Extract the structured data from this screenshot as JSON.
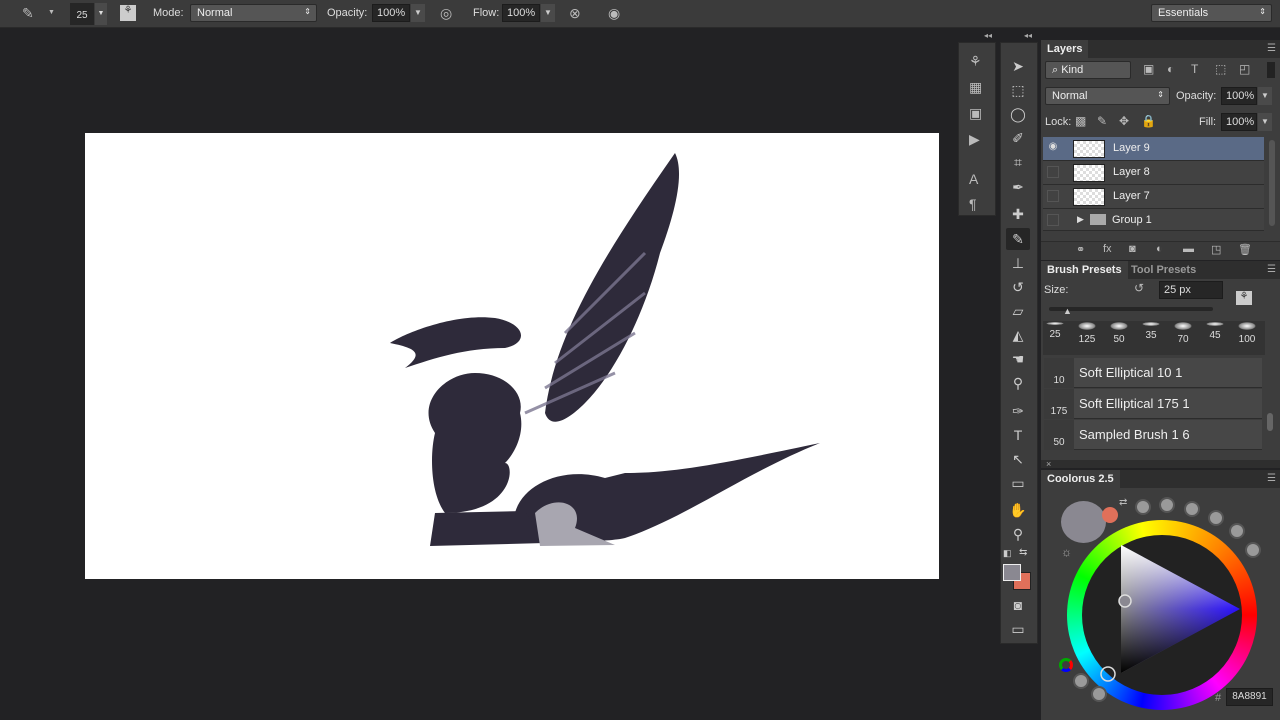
{
  "options_bar": {
    "brush_size": "25",
    "mode_label": "Mode:",
    "mode_value": "Normal",
    "opacity_label": "Opacity:",
    "opacity_value": "100%",
    "flow_label": "Flow:",
    "flow_value": "100%",
    "workspace": "Essentials"
  },
  "layers_panel": {
    "title": "Layers",
    "filter": "Kind",
    "blend_mode": "Normal",
    "opacity_label": "Opacity:",
    "opacity_value": "100%",
    "lock_label": "Lock:",
    "fill_label": "Fill:",
    "fill_value": "100%",
    "layers": [
      {
        "name": "Layer 9",
        "visible": true,
        "selected": true
      },
      {
        "name": "Layer 8",
        "visible": false
      },
      {
        "name": "Layer 7",
        "visible": false
      },
      {
        "name": "Group 1",
        "visible": false,
        "group": true
      }
    ]
  },
  "brush_panel": {
    "tab_active": "Brush Presets",
    "tab_inactive": "Tool Presets",
    "size_label": "Size:",
    "size_value": "25 px",
    "preset_sizes": [
      "25",
      "125",
      "50",
      "35",
      "70",
      "45",
      "100"
    ],
    "brushes": [
      {
        "size": "10",
        "name": "Soft Elliptical 10 1"
      },
      {
        "size": "175",
        "name": "Soft Elliptical 175 1"
      },
      {
        "size": "50",
        "name": "Sampled Brush 1 6"
      }
    ]
  },
  "coolorus": {
    "title": "Coolorus 2.5",
    "hash": "#",
    "hex": "8A8891",
    "foreground": "#8A8891",
    "background": "#E0705A"
  },
  "colors": {
    "foreground": "#8a8891",
    "background": "#e0705a"
  }
}
